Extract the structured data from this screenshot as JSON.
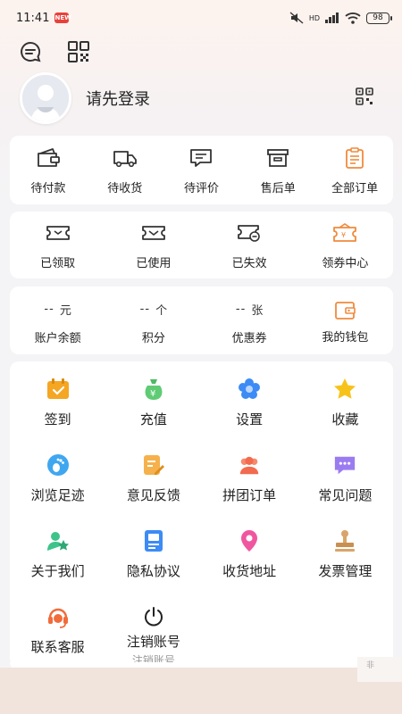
{
  "status_bar": {
    "time": "11:41",
    "app_badge": "NEW",
    "signal_text": "HD",
    "battery": "98"
  },
  "profile": {
    "name": "请先登录"
  },
  "orders": [
    {
      "label": "待付款",
      "icon": "wallet-icon"
    },
    {
      "label": "待收货",
      "icon": "truck-icon"
    },
    {
      "label": "待评价",
      "icon": "comment-icon"
    },
    {
      "label": "售后单",
      "icon": "box-icon"
    },
    {
      "label": "全部订单",
      "icon": "clipboard-icon"
    }
  ],
  "coupons": [
    {
      "label": "已领取",
      "icon": "ticket-icon"
    },
    {
      "label": "已使用",
      "icon": "ticket-used-icon"
    },
    {
      "label": "已失效",
      "icon": "ticket-expired-icon"
    },
    {
      "label": "领券中心",
      "icon": "coupon-center-icon"
    }
  ],
  "assets": [
    {
      "value": "--",
      "unit": "元",
      "label": "账户余额"
    },
    {
      "value": "--",
      "unit": "个",
      "label": "积分"
    },
    {
      "value": "--",
      "unit": "张",
      "label": "优惠券"
    },
    {
      "label": "我的钱包",
      "icon": "wallet-orange-icon"
    }
  ],
  "services": [
    {
      "label": "签到",
      "icon": "calendar-check-icon",
      "color": "#f5a623"
    },
    {
      "label": "充值",
      "icon": "money-bag-icon",
      "color": "#52c46b"
    },
    {
      "label": "设置",
      "icon": "flower-gear-icon",
      "color": "#3d8bf5"
    },
    {
      "label": "收藏",
      "icon": "star-icon",
      "color": "#f7c31a"
    },
    {
      "label": "浏览足迹",
      "icon": "footprint-icon",
      "color": "#3fa7f0"
    },
    {
      "label": "意见反馈",
      "icon": "feedback-icon",
      "color": "#f5b14c"
    },
    {
      "label": "拼团订单",
      "icon": "group-icon",
      "color": "#f26b4f"
    },
    {
      "label": "常见问题",
      "icon": "faq-chat-icon",
      "color": "#9b7cf0"
    },
    {
      "label": "关于我们",
      "icon": "about-user-icon",
      "color": "#3ec48a"
    },
    {
      "label": "隐私协议",
      "icon": "privacy-doc-icon",
      "color": "#3d8bf5"
    },
    {
      "label": "收货地址",
      "icon": "location-pin-icon",
      "color": "#f056a0"
    },
    {
      "label": "发票管理",
      "icon": "stamp-icon",
      "color": "#d9a46a"
    },
    {
      "label": "联系客服",
      "icon": "headset-icon",
      "color": "#f26b3a"
    },
    {
      "label": "注销账号",
      "sub": "注销账号",
      "icon": "power-icon",
      "color": "#222222"
    }
  ],
  "corner_text": "非"
}
